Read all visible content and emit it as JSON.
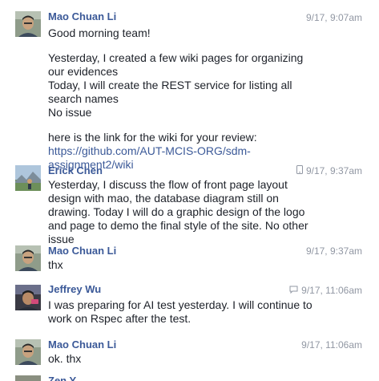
{
  "messages": [
    {
      "author": "Mao Chuan Li",
      "time": "9/17, 9:07am",
      "lines": [
        "Good morning team!",
        "",
        "Yesterday, I created a few wiki pages for organizing our evidences",
        "Today, I will create the REST service for listing all search names",
        "No issue",
        "",
        "here is the link for the wiki for your review:"
      ],
      "link": "https://github.com/AUT-MCIS-ORG/sdm-assignment2/wiki"
    },
    {
      "author": "Erick Chen",
      "time": "9/17, 9:37am",
      "icon": "mobile-icon",
      "text": "Yesterday, I discuss the flow of front page layout design with mao, the database diagram still on drawing. Today I will do a graphic design of the logo and page to demo the final style of the site. No other issue"
    },
    {
      "author": "Mao Chuan Li",
      "time": "9/17, 9:37am",
      "text": "thx"
    },
    {
      "author": "Jeffrey Wu",
      "time": "9/17, 11:06am",
      "icon": "chat-bubble-icon",
      "text": "I was preparing for AI test yesterday. I will continue to work on Rspec after the test."
    },
    {
      "author": "Mao Chuan Li",
      "time": "9/17, 11:06am",
      "text": "ok. thx"
    }
  ],
  "partial_author": "Zen Y"
}
